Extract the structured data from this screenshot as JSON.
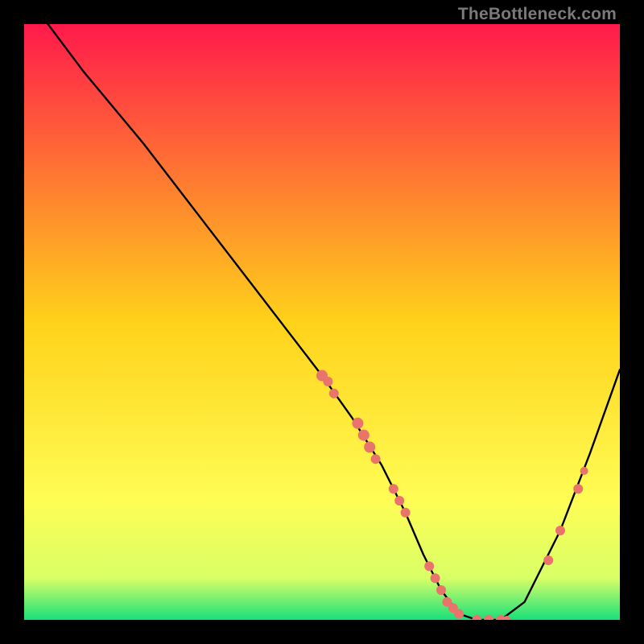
{
  "watermark": "TheBottleneck.com",
  "chart_data": {
    "type": "line",
    "title": "",
    "xlabel": "",
    "ylabel": "",
    "xlim": [
      0,
      100
    ],
    "ylim": [
      0,
      100
    ],
    "grid": false,
    "legend": false,
    "gradient_stops": [
      {
        "offset": 0.0,
        "color": "#ff1a4b"
      },
      {
        "offset": 0.5,
        "color": "#ffd21a"
      },
      {
        "offset": 0.8,
        "color": "#fffd55"
      },
      {
        "offset": 0.93,
        "color": "#d8ff66"
      },
      {
        "offset": 1.0,
        "color": "#18e07a"
      }
    ],
    "series": [
      {
        "name": "bottleneck-curve",
        "x": [
          4,
          10,
          20,
          30,
          40,
          50,
          55,
          60,
          64,
          67,
          70,
          73,
          76,
          80,
          84,
          90,
          95,
          100
        ],
        "y": [
          100,
          92,
          80,
          67,
          54,
          41,
          34,
          26,
          18,
          11,
          5,
          1,
          0,
          0,
          3,
          15,
          28,
          42
        ]
      }
    ],
    "marker_points": {
      "name": "highlighted-points",
      "color": "#e9746b",
      "points": [
        {
          "x": 50,
          "y": 41,
          "r": 7
        },
        {
          "x": 51,
          "y": 40,
          "r": 6
        },
        {
          "x": 52,
          "y": 38,
          "r": 6
        },
        {
          "x": 56,
          "y": 33,
          "r": 7
        },
        {
          "x": 57,
          "y": 31,
          "r": 7
        },
        {
          "x": 58,
          "y": 29,
          "r": 7
        },
        {
          "x": 59,
          "y": 27,
          "r": 6
        },
        {
          "x": 62,
          "y": 22,
          "r": 6
        },
        {
          "x": 63,
          "y": 20,
          "r": 6
        },
        {
          "x": 64,
          "y": 18,
          "r": 6
        },
        {
          "x": 68,
          "y": 9,
          "r": 6
        },
        {
          "x": 69,
          "y": 7,
          "r": 6
        },
        {
          "x": 70,
          "y": 5,
          "r": 6
        },
        {
          "x": 71,
          "y": 3,
          "r": 6
        },
        {
          "x": 72,
          "y": 2,
          "r": 6
        },
        {
          "x": 73,
          "y": 1,
          "r": 6
        },
        {
          "x": 76,
          "y": 0,
          "r": 6
        },
        {
          "x": 78,
          "y": 0,
          "r": 6
        },
        {
          "x": 80,
          "y": 0,
          "r": 6
        },
        {
          "x": 81,
          "y": 0,
          "r": 5
        },
        {
          "x": 88,
          "y": 10,
          "r": 6
        },
        {
          "x": 90,
          "y": 15,
          "r": 6
        },
        {
          "x": 93,
          "y": 22,
          "r": 6
        },
        {
          "x": 94,
          "y": 25,
          "r": 5
        }
      ]
    }
  }
}
